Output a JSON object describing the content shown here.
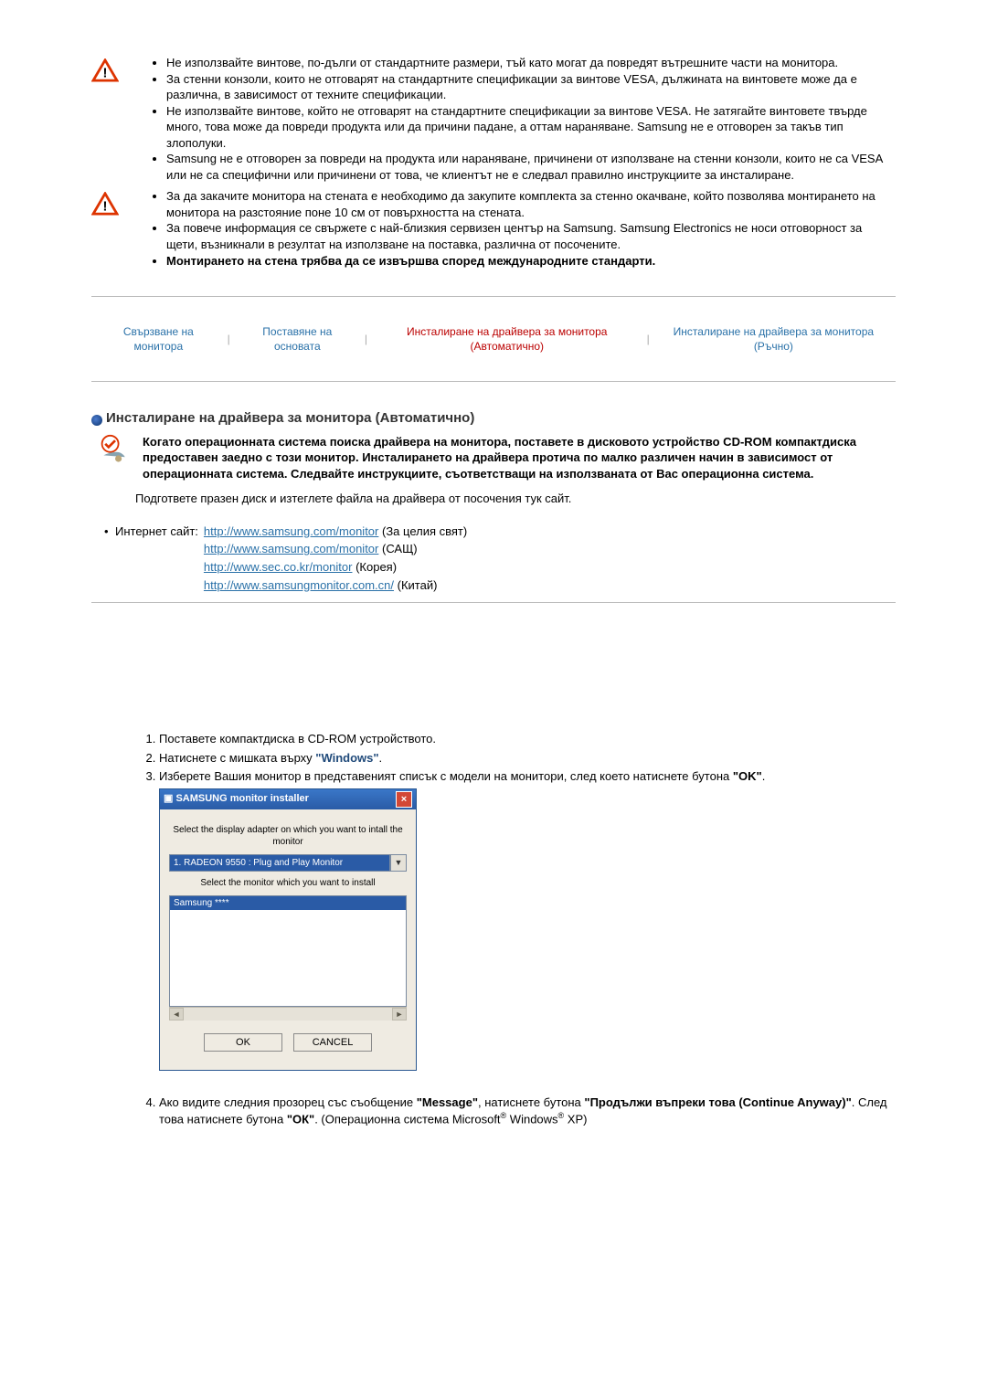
{
  "warnings1": [
    "Не използвайте винтове, по-дълги от стандартните размери, тъй като могат да повредят вътрешните части на монитора.",
    "За стенни конзоли, които не отговарят на стандартните спецификации за винтове VESA, дължината на винтовете може да е различна, в зависимост от техните спецификации.",
    "Не използвайте винтове, който не отговарят на стандартните спецификации за винтове VESA. Не затягайте винтовете твърде много, това може да повреди продукта или да причини падане, а оттам нараняване. Samsung не е отговорен за такъв тип злополуки.",
    "Samsung не е отговорен за повреди на продукта или нараняване, причинени от използване на стенни конзоли, които не са VESA или не са специфични или причинени от това, че клиентът не е следвал правилно инструкциите за инсталиране."
  ],
  "warnings2": [
    "За да закачите монитора на стената е необходимо да закупите комплекта за стенно окачване, който позволява монтирането на монитора на разстояние поне 10 см от повърхността на стената.",
    "За повече информация се свържете с най-близкия сервизен център на Samsung. Samsung Electronics не носи отговорност за щети, възникнали в резултат на използване на поставка, различна от посочените."
  ],
  "warning2_bold": "Монтирането на стена трябва да се извършва според международните стандарти.",
  "tabs": {
    "t1": "Свързване на монитора",
    "t2": "Поставяне на основата",
    "t3": "Инсталиране на драйвера за монитора (Автоматично)",
    "t4": "Инсталиране на драйвера за монитора (Ръчно)"
  },
  "section": {
    "title": "Инсталиране на драйвера за монитора (Автоматично)",
    "intro": "Когато операционната система поиска драйвера на монитора, поставете в дисковото устройство CD-ROM компактдиска предоставен заедно с този монитор. Инсталирането на драйвера протича по малко различен начин в зависимост от операционната система. Следвайте инструкциите, съответстващи на използваната от Вас операционна система.",
    "prepare": "Подгответе празен диск и изтеглете файла на драйвера от посочения тук сайт."
  },
  "sites": {
    "label": "Интернет сайт:",
    "items": [
      {
        "url": "http://www.samsung.com/monitor",
        "suffix": "(За целия свят)"
      },
      {
        "url": "http://www.samsung.com/monitor",
        "suffix": "(САЩ)"
      },
      {
        "url": "http://www.sec.co.kr/monitor",
        "suffix": "(Корея)"
      },
      {
        "url": "http://www.samsungmonitor.com.cn/",
        "suffix": "(Китай)"
      }
    ]
  },
  "steps_a": {
    "s1": "Поставете компактдиска в CD-ROM устройството.",
    "s2_pre": "Натиснете с мишката върху ",
    "s2_link": "\"Windows\"",
    "s2_post": ".",
    "s3_pre": "Изберете Вашия монитор в представеният списък с модели на монитори, след което натиснете бутона ",
    "s3_bold": "\"OK\"",
    "s3_post": "."
  },
  "installer": {
    "title": "SAMSUNG monitor installer",
    "label1": "Select the display adapter on which you want to intall the monitor",
    "adapter": "1. RADEON 9550 : Plug and Play Monitor",
    "label2": "Select the monitor which you want to install",
    "selected": "Samsung ****",
    "ok": "OK",
    "cancel": "CANCEL"
  },
  "step4": {
    "pre": "Ако видите следния прозорец със съобщение ",
    "msg": "\"Message\"",
    "mid": ", натиснете бутона ",
    "cont": "\"Продължи въпреки това (Continue Anyway)\"",
    "mid2": ". След това натиснете бутона ",
    "ok": "\"ОК\"",
    "post": ". (Операционна система Microsoft",
    "reg": "®",
    "win": " Windows",
    "reg2": "®",
    "xp": " XP)"
  }
}
